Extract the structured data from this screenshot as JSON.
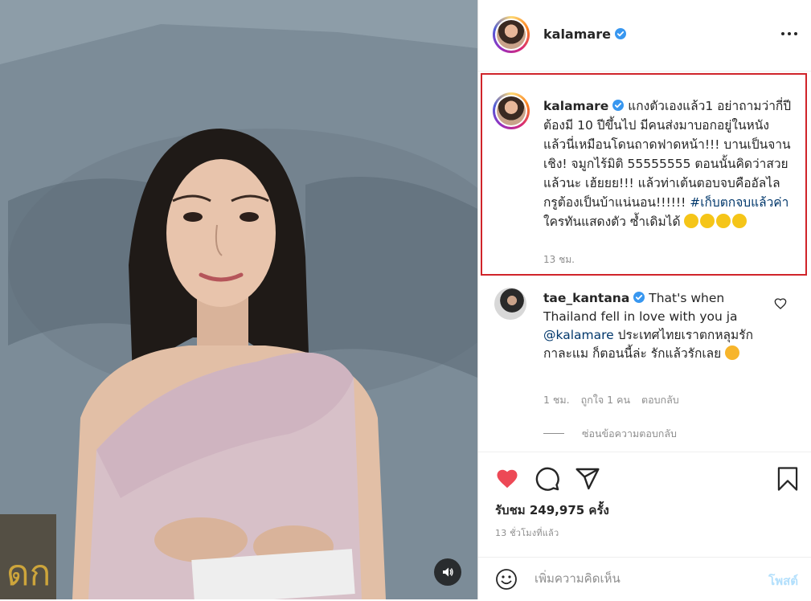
{
  "post": {
    "username": "kalamare",
    "verified": true,
    "caption": {
      "username": "kalamare",
      "text": "แกงตัวเองแล้ว1 อย่าถามว่ากี่ปี ต้องมี 10 ปีขึ้นไป มีคนส่งมาบอกอยู่ในหนัง แล้วนี่เหมือนโดนถาดฟาดหน้า!!! บานเป็นจานเชิง! จมูกไร้มิติ 55555555 ตอนนั้นคิดว่าสวยแล้วนะ เฮ้ยยย!!! แล้วท่าเต้นตอบจบคืออัลไล กรูต้องเป็นบ้าแน่นอน!!!!!! ",
      "hashtag": "#เก็บตกจบแล้วค่า",
      "text_after": " ใครทันแสดงตัว ซ้ำเดิมได้ ",
      "emoji_count": 4,
      "time": "13 ชม."
    },
    "comment": {
      "username": "tae_kantana",
      "verified": true,
      "text": " That's when Thailand fell in love with you ja ",
      "mention": "@kalamare",
      "text_after": " ประเทศไทยเราตกหลุมรัก กาละแม ก็ตอนนี้ล่ะ รักแล้วรักเลย ",
      "time": "1 ชม.",
      "likes": "ถูกใจ 1 คน",
      "reply": "ตอบกลับ",
      "hide_replies": "ซ่อนข้อความตอบกลับ"
    },
    "views": "รับชม 249,975 ครั้ง",
    "posted": "13 ชั่วโมงที่แล้ว",
    "comment_placeholder": "เพิ่มความคิดเห็น",
    "post_button": "โพสต์",
    "liked": true
  },
  "colors": {
    "like_red": "#ed4956",
    "verified_blue": "#3897f0",
    "highlight_border": "#d0242a",
    "link": "#00376b",
    "muted": "#8e8e8e"
  },
  "icons": [
    "verified-badge-icon",
    "more-options-icon",
    "heart-icon",
    "comment-icon",
    "share-icon",
    "bookmark-icon",
    "emoji-icon",
    "sound-icon",
    "emoji-face-icon"
  ]
}
